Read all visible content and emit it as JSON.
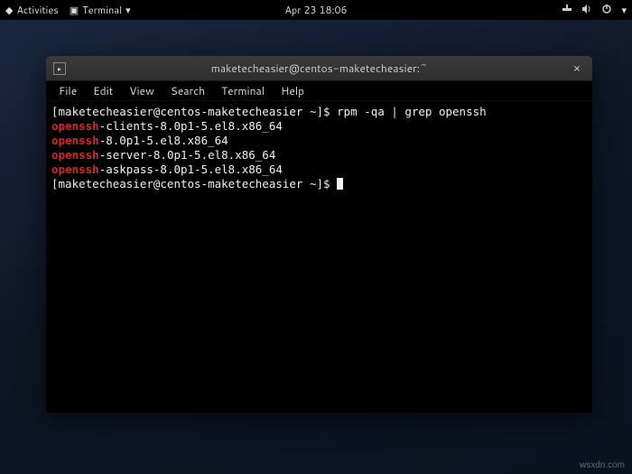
{
  "topbar": {
    "activities": "Activities",
    "app_name": "Terminal",
    "datetime": "Apr 23  18:06"
  },
  "window": {
    "title": "maketecheasier@centos-maketecheasier:~",
    "close": "×"
  },
  "menubar": {
    "file": "File",
    "edit": "Edit",
    "view": "View",
    "search": "Search",
    "terminal": "Terminal",
    "help": "Help"
  },
  "terminal": {
    "prompt1_left": "[maketecheasier@centos-maketecheasier ~]$ ",
    "command": "rpm -qa | grep openssh",
    "match": "openssh",
    "line1_rest": "-clients-8.0p1-5.el8.x86_64",
    "line2_rest": "-8.0p1-5.el8.x86_64",
    "line3_rest": "-server-8.0p1-5.el8.x86_64",
    "line4_rest": "-askpass-8.0p1-5.el8.x86_64",
    "prompt2_left": "[maketecheasier@centos-maketecheasier ~]$ "
  },
  "watermark": "wsxdn.com"
}
